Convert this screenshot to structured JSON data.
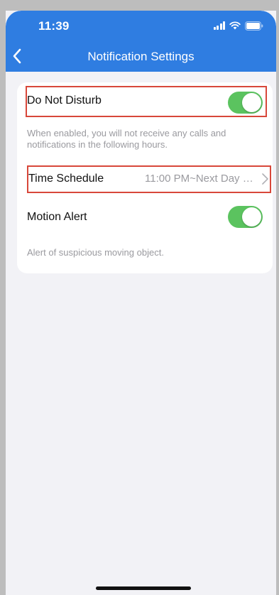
{
  "status_bar": {
    "time": "11:39"
  },
  "header": {
    "title": "Notification Settings",
    "back_icon": "chevron-left-icon"
  },
  "settings": {
    "do_not_disturb": {
      "label": "Do Not Disturb",
      "enabled": true,
      "hint": "When enabled, you will not receive any calls and notifications in the following hours."
    },
    "time_schedule": {
      "label": "Time Schedule",
      "value": "11:00 PM~Next Day 7:..."
    },
    "motion_alert": {
      "label": "Motion Alert",
      "enabled": true,
      "hint": "Alert of suspicious moving object."
    }
  },
  "colors": {
    "header_bg": "#2f7de1",
    "toggle_on": "#5bc35f",
    "highlight": "#d8473a",
    "page_bg": "#f2f2f6"
  }
}
